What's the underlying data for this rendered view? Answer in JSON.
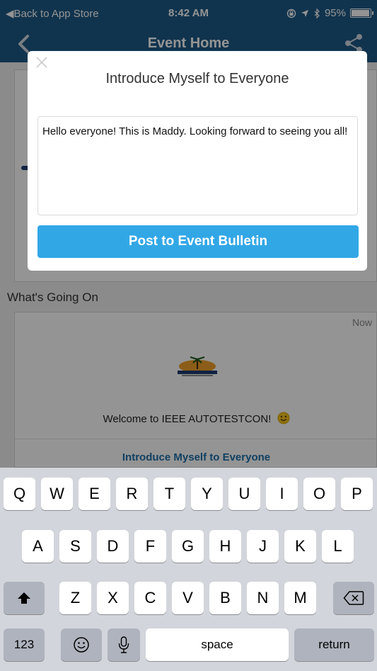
{
  "status_bar": {
    "back_label": "◀Back to App Store",
    "time": "8:42 AM",
    "battery": "95%",
    "battery_fraction": 0.95,
    "icons": [
      "lock-rotation-icon",
      "location-arrow-icon",
      "bluetooth-icon",
      "battery-icon"
    ]
  },
  "nav": {
    "title": "Event Home",
    "back_icon": "chevron-left-icon",
    "share_icon": "share-icon"
  },
  "background": {
    "section_title": "What's Going On",
    "card": {
      "time": "Now",
      "welcome_text": "Welcome to IEEE AUTOTESTCON!",
      "link_label": "Introduce Myself to Everyone",
      "emoji_icon": "smiley-icon"
    }
  },
  "modal": {
    "title": "Introduce Myself to Everyone",
    "message": "Hello everyone! This is Maddy. Looking forward to seeing you all!",
    "post_button": "Post to Event Bulletin",
    "close_icon": "close-icon",
    "button_color": "#32a7e6"
  },
  "keyboard": {
    "row1": [
      "Q",
      "W",
      "E",
      "R",
      "T",
      "Y",
      "U",
      "I",
      "O",
      "P"
    ],
    "row2": [
      "A",
      "S",
      "D",
      "F",
      "G",
      "H",
      "J",
      "K",
      "L"
    ],
    "row3": [
      "Z",
      "X",
      "C",
      "V",
      "B",
      "N",
      "M"
    ],
    "numbers_key": "123",
    "space_key": "space",
    "return_key": "return",
    "icons": [
      "shift-icon",
      "backspace-icon",
      "emoji-icon",
      "microphone-icon"
    ]
  },
  "colors": {
    "nav_bar": "#1e5b87",
    "accent": "#32a7e6",
    "link": "#1e6fa8"
  }
}
